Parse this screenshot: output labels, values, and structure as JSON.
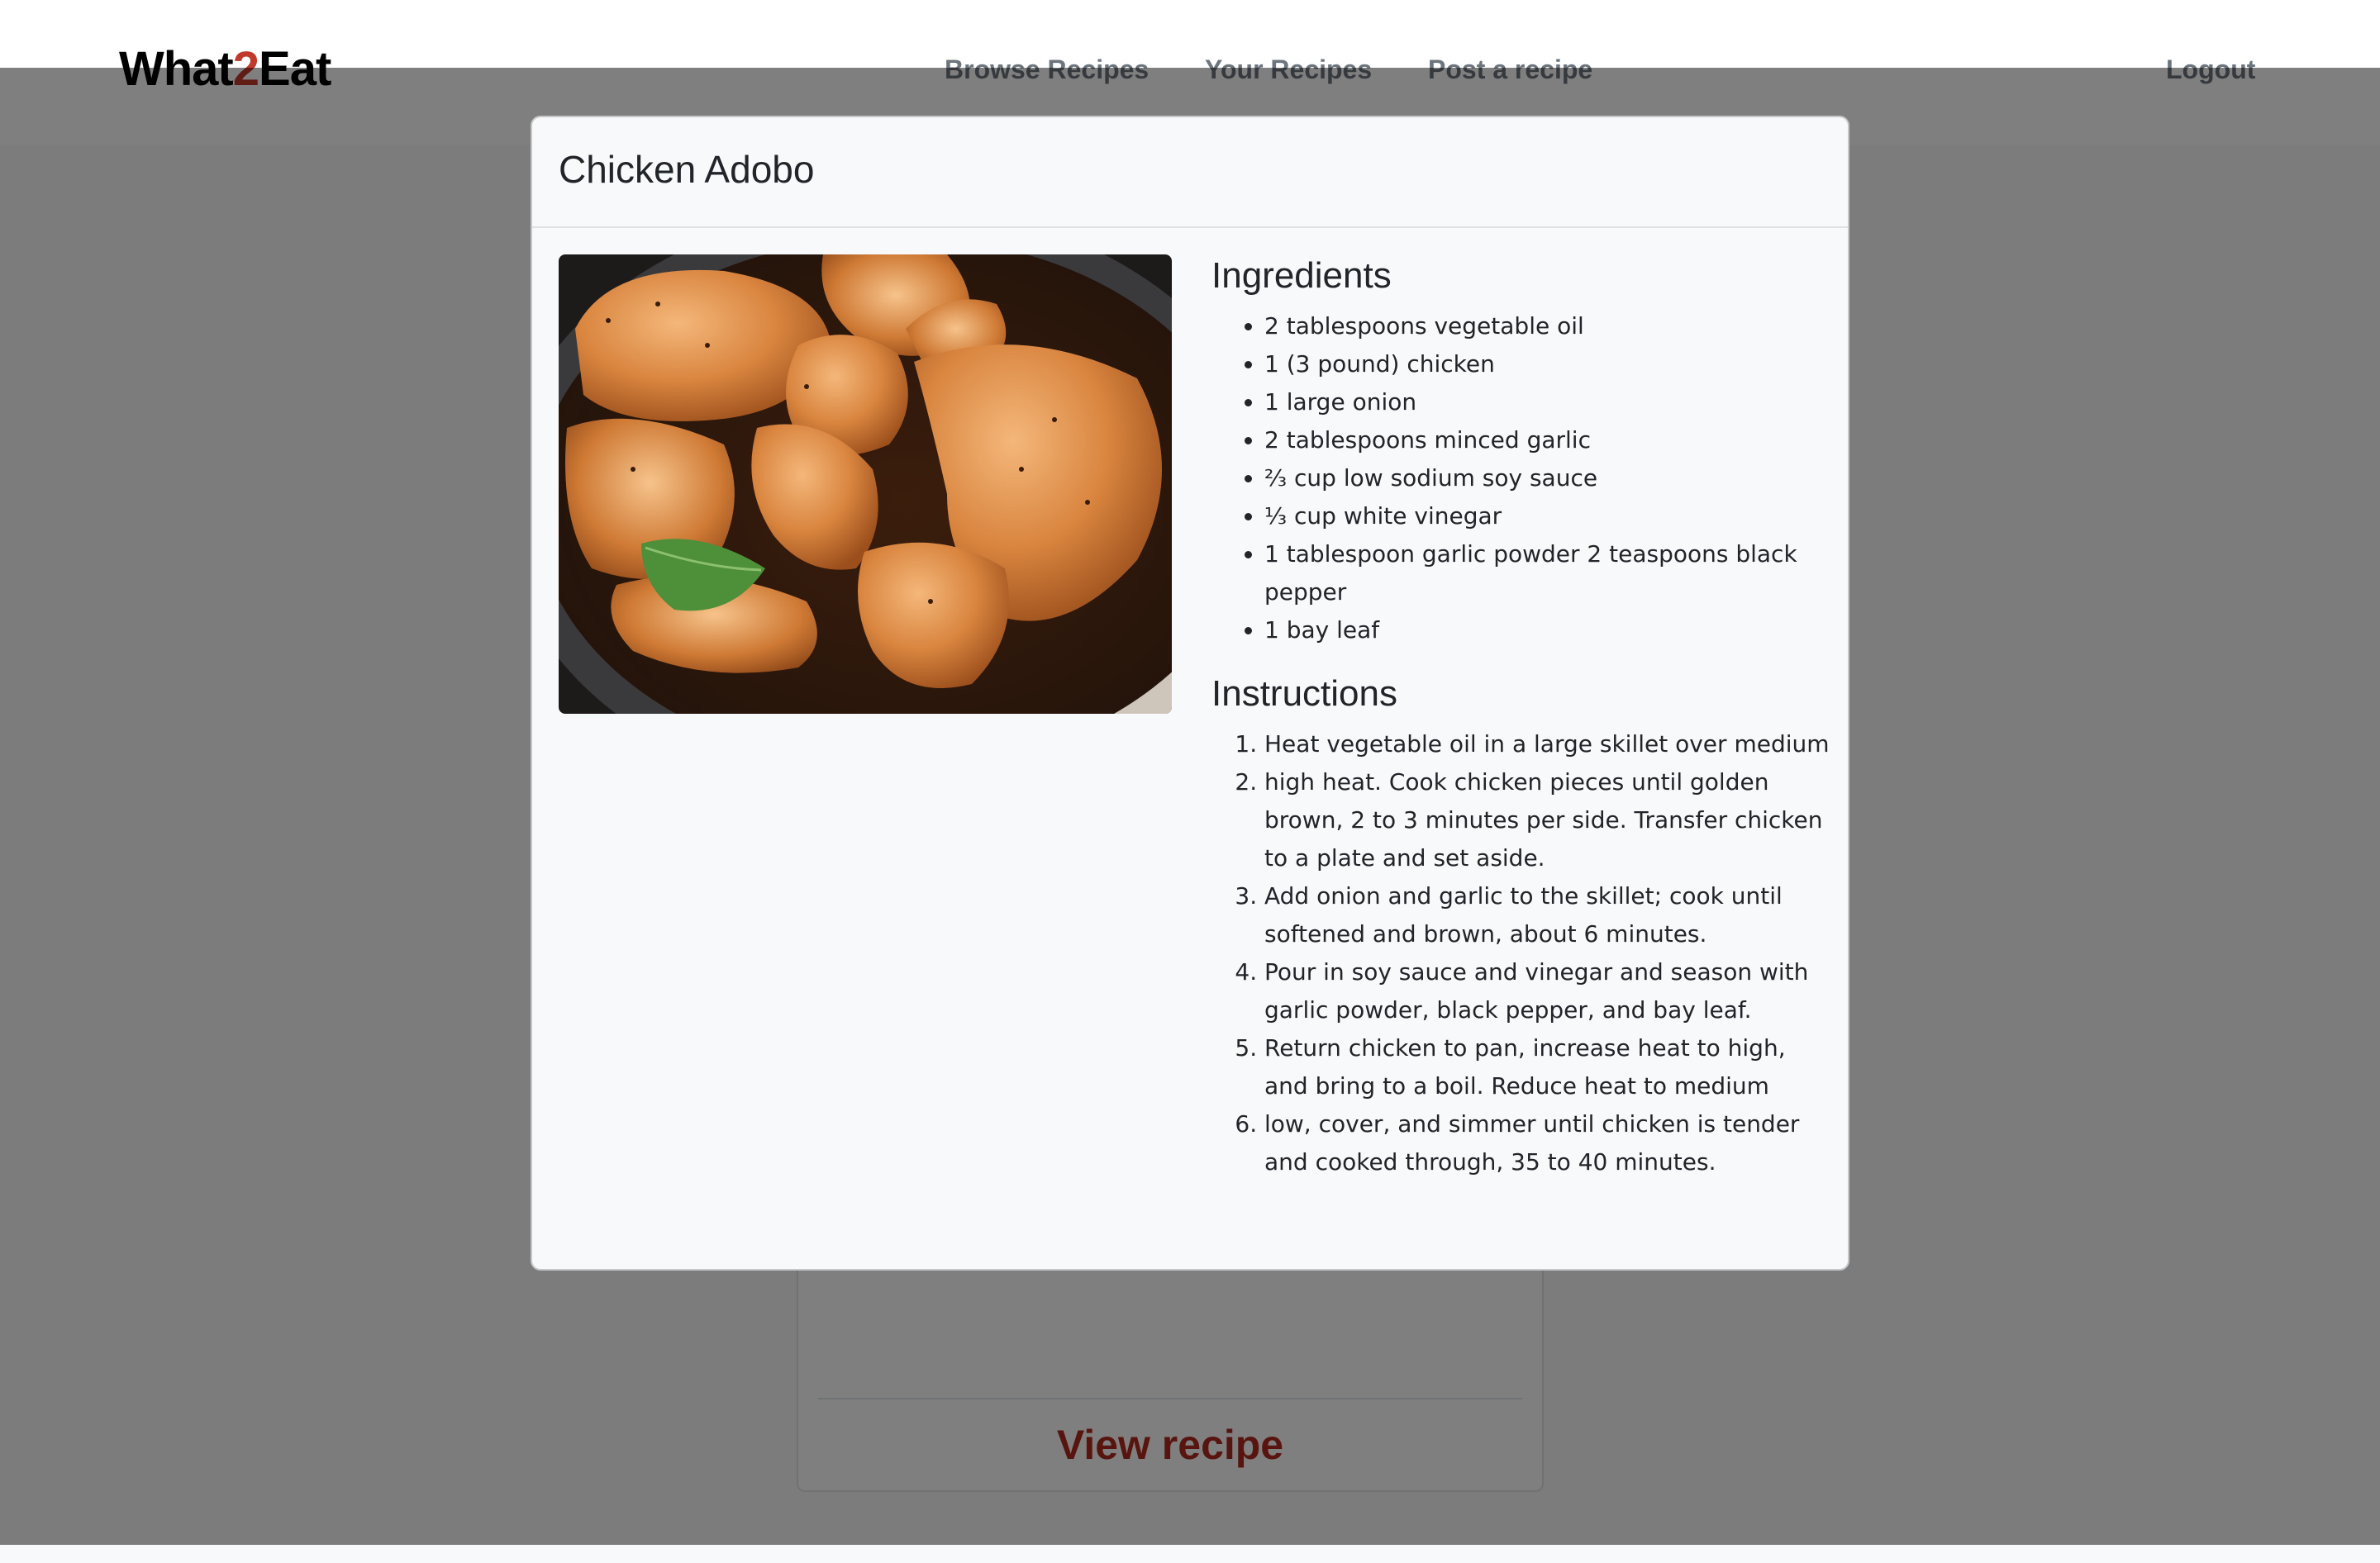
{
  "brand": {
    "prefix": "What",
    "accent": "2",
    "suffix": "Eat",
    "accent_color": "#c0392b"
  },
  "nav": {
    "links": [
      "Browse Recipes",
      "Your Recipes",
      "Post a recipe"
    ],
    "logout": "Logout"
  },
  "card": {
    "view_recipe": "View recipe"
  },
  "modal": {
    "title": "Chicken Adobo",
    "image": {
      "subject": "Pan-seared chicken pieces with a bay leaf in a dark skillet"
    },
    "ingredients_heading": "Ingredients",
    "ingredients": [
      "2 tablespoons vegetable oil",
      "1 (3 pound) chicken",
      "1 large onion",
      "2 tablespoons minced garlic",
      "⅔ cup low sodium soy sauce",
      "⅓ cup white vinegar",
      "1 tablespoon garlic powder 2 teaspoons black pepper",
      "1 bay leaf"
    ],
    "instructions_heading": "Instructions",
    "instructions": [
      "Heat vegetable oil in a large skillet over medium",
      "high heat. Cook chicken pieces until golden brown, 2 to 3 minutes per side. Transfer chicken to a plate and set aside.",
      "Add onion and garlic to the skillet; cook until softened and brown, about 6 minutes.",
      "Pour in soy sauce and vinegar and season with garlic powder, black pepper, and bay leaf.",
      "Return chicken to pan, increase heat to high, and bring to a boil. Reduce heat to medium",
      "low, cover, and simmer until chicken is tender and cooked through, 35 to 40 minutes."
    ]
  }
}
